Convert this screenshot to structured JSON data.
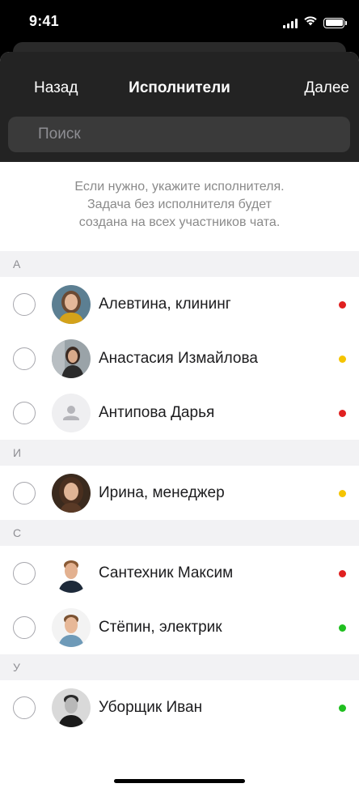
{
  "status_bar": {
    "time": "9:41"
  },
  "header": {
    "back_label": "Назад",
    "title": "Исполнители",
    "next_label": "Далее",
    "search_placeholder": "Поиск"
  },
  "hint": {
    "lines": [
      "Если нужно, укажите исполнителя.",
      "Задача без исполнителя будет",
      "создана на всех участников чата."
    ]
  },
  "sections": [
    {
      "letter": "А",
      "contacts": [
        {
          "name": "Алевтина, клининг",
          "status_color": "#e02020",
          "avatar": "photo-woman-1"
        },
        {
          "name": "Анастасия Измайлова",
          "status_color": "#f5c400",
          "avatar": "photo-woman-2"
        },
        {
          "name": "Антипова Дарья",
          "status_color": "#e02020",
          "avatar": "person-placeholder-icon"
        }
      ]
    },
    {
      "letter": "И",
      "contacts": [
        {
          "name": "Ирина, менеджер",
          "status_color": "#f5c400",
          "avatar": "photo-woman-3"
        }
      ]
    },
    {
      "letter": "С",
      "contacts": [
        {
          "name": "Сантехник Максим",
          "status_color": "#e02020",
          "avatar": "photo-man-1"
        },
        {
          "name": "Стёпин, электрик",
          "status_color": "#1fbf1f",
          "avatar": "photo-man-2"
        }
      ]
    },
    {
      "letter": "У",
      "contacts": [
        {
          "name": "Уборщик Иван",
          "status_color": "#1fbf1f",
          "avatar": "photo-man-3"
        }
      ]
    }
  ]
}
